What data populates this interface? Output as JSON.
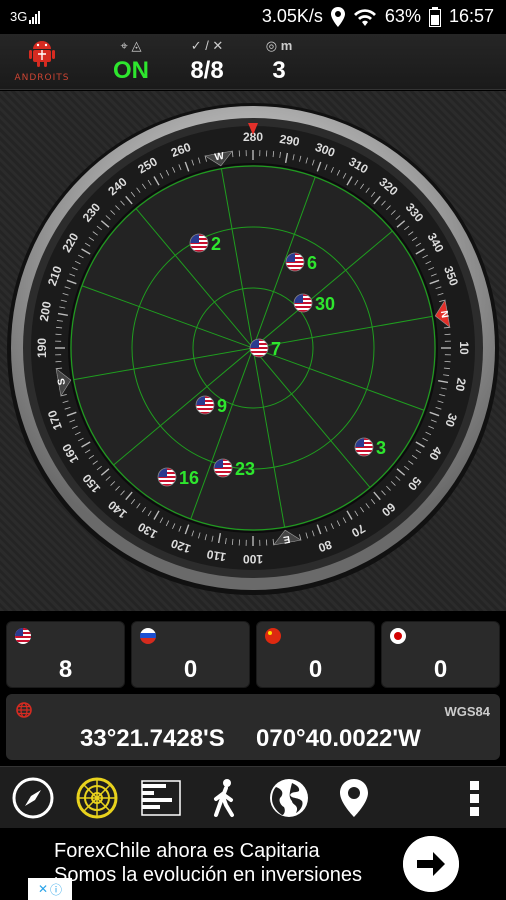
{
  "status_bar": {
    "network": "3G",
    "speed": "3.05K/s",
    "battery": "63%",
    "time": "16:57"
  },
  "header": {
    "brand": "ANDROITS",
    "fix_status": "ON",
    "satellites": "8/8",
    "accuracy_unit": "m",
    "accuracy": "3"
  },
  "compass": {
    "cardinals": {
      "n": "N",
      "e": "E",
      "s": "S",
      "w": "W"
    },
    "degree_labels": [
      "10",
      "20",
      "30",
      "40",
      "50",
      "60",
      "70",
      "80",
      "100",
      "110",
      "120",
      "130",
      "140",
      "150",
      "160",
      "170",
      "190",
      "200",
      "210",
      "220",
      "230",
      "240",
      "250",
      "260",
      "280",
      "290",
      "300",
      "310",
      "320",
      "330",
      "340",
      "350"
    ]
  },
  "satellites": [
    {
      "id": "2",
      "flag": "us"
    },
    {
      "id": "6",
      "flag": "us"
    },
    {
      "id": "30",
      "flag": "us"
    },
    {
      "id": "7",
      "flag": "us"
    },
    {
      "id": "9",
      "flag": "us"
    },
    {
      "id": "3",
      "flag": "us"
    },
    {
      "id": "23",
      "flag": "us"
    },
    {
      "id": "16",
      "flag": "us"
    }
  ],
  "constellations": [
    {
      "name": "gps",
      "count": "8"
    },
    {
      "name": "glonass",
      "count": "0"
    },
    {
      "name": "beidou",
      "count": "0"
    },
    {
      "name": "qzss",
      "count": "0"
    }
  ],
  "coordinates": {
    "datum": "WGS84",
    "latitude": "33°21.7428'S",
    "longitude": "070°40.0022'W"
  },
  "toolbar": {
    "items": [
      "compass-icon",
      "radar-icon",
      "signal-bars-icon",
      "walk-icon",
      "globe-icon",
      "location-pin-icon",
      "more-vert-icon"
    ]
  },
  "ad": {
    "line1": "ForexChile ahora es Capitaria",
    "line2": "Somos la evolución en inversiones"
  },
  "colors": {
    "accent_green": "#2ee62e",
    "radar_green": "#1f9e1f",
    "north_red": "#e3302a"
  }
}
